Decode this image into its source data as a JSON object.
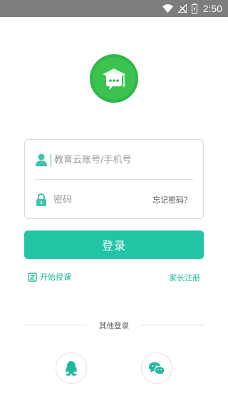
{
  "status_bar": {
    "time": "2:50",
    "icons": [
      "wifi-icon",
      "signal-icon",
      "battery-icon"
    ]
  },
  "login_form": {
    "account_placeholder": "教育云账号/手机号",
    "password_placeholder": "密码",
    "forgot_password_label": "忘记密码？"
  },
  "login_button_label": "登录",
  "links": {
    "start_class_label": "开始授课",
    "register_label": "家长注册"
  },
  "other_login": {
    "label": "其他登录",
    "providers": [
      "qq-icon",
      "wechat-icon"
    ]
  },
  "colors": {
    "accent": "#21c4a5",
    "link": "#1db89b",
    "status_bar": "#7d7d7d"
  }
}
